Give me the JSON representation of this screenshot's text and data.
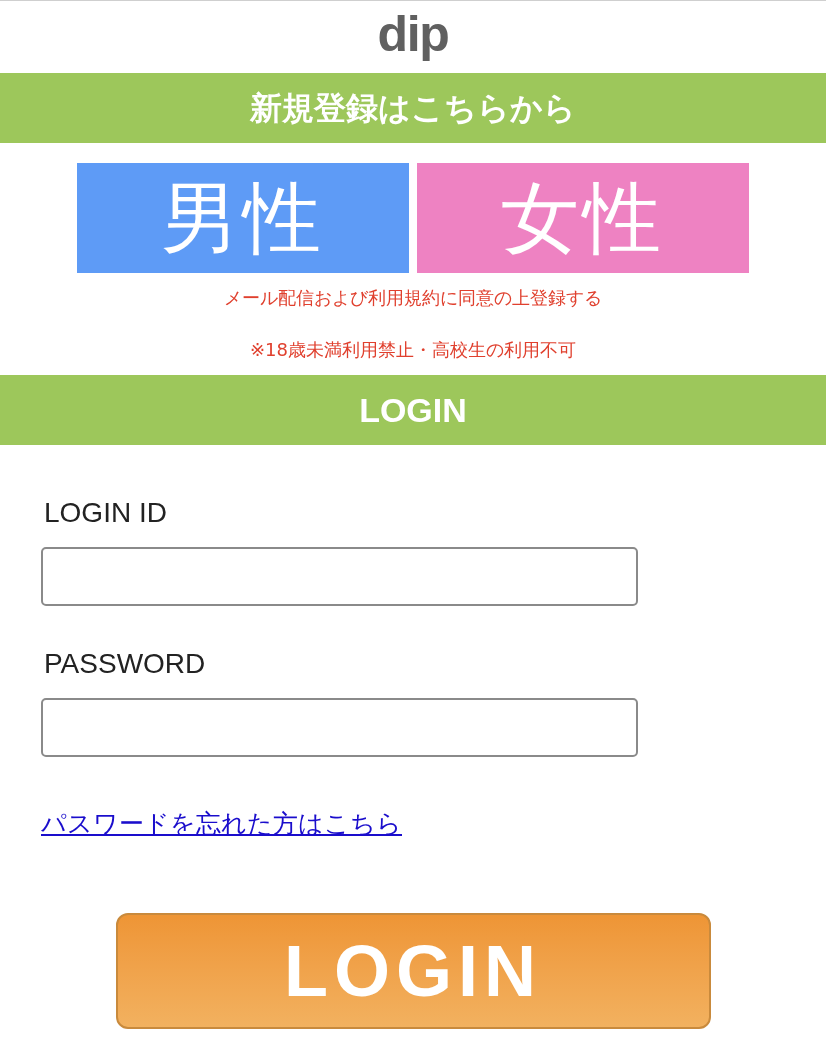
{
  "logo": "dip",
  "register_banner": "新規登録はこちらから",
  "gender_buttons": [
    {
      "label": "男性",
      "kind": "male"
    },
    {
      "label": "女性",
      "kind": "female"
    }
  ],
  "notices": [
    "メール配信および利用規約に同意の上登録する",
    "※18歳未満利用禁止・高校生の利用不可"
  ],
  "login_banner": "LOGIN",
  "fields": [
    {
      "label": "LOGIN ID"
    },
    {
      "label": "PASSWORD"
    }
  ],
  "forgot_link": "パスワードを忘れた方はこちら",
  "login_button": "LOGIN"
}
